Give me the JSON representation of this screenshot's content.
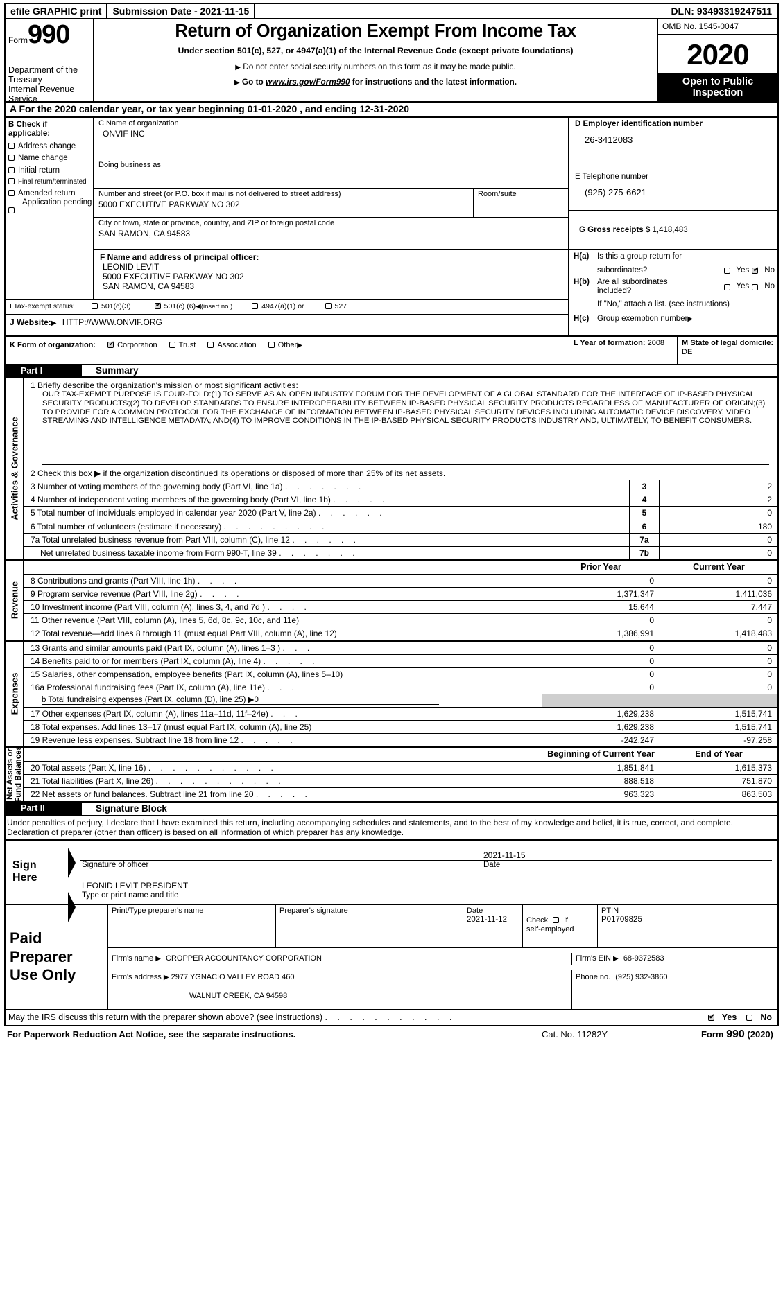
{
  "efile": {
    "graphic": "efile GRAPHIC print",
    "submission": "Submission Date - 2021-11-15",
    "dln": "DLN: 93493319247511"
  },
  "masthead": {
    "form_label": "Form",
    "form_number": "990",
    "department": "Department of the Treasury Internal Revenue Service",
    "title": "Return of Organization Exempt From Income Tax",
    "subtitle": "Under section 501(c), 527, or 4947(a)(1) of the Internal Revenue Code (except private foundations)",
    "bullet1": "Do not enter social security numbers on this form as it may be made public.",
    "bullet2_pre": "Go to ",
    "bullet2_link": "www.irs.gov/Form990",
    "bullet2_post": " for instructions and the latest information.",
    "omb": "OMB No. 1545-0047",
    "year": "2020",
    "open_line1": "Open to Public",
    "open_line2": "Inspection"
  },
  "lineA": "A   For the 2020 calendar year, or tax year beginning 01-01-2020   , and ending 12-31-2020",
  "checkbox_B": {
    "title": "B  Check if applicable:",
    "items": [
      {
        "label": "Address change",
        "checked": false
      },
      {
        "label": "Name change",
        "checked": false
      },
      {
        "label": "Initial return",
        "checked": false
      },
      {
        "label": "Final return/terminated",
        "checked": false
      },
      {
        "label": "Amended return",
        "checked": false
      },
      {
        "label": "Application pending",
        "checked": false
      }
    ]
  },
  "org": {
    "c_label": "C Name of organization",
    "c_value": "ONVIF INC",
    "dba_label": "Doing business as",
    "dba_value": "",
    "street_label": "Number and street (or P.O. box if mail is not delivered to street address)",
    "street_value": "5000 EXECUTIVE PARKWAY NO 302",
    "room_label": "Room/suite",
    "room_value": "",
    "city_label": "City or town, state or province, country, and ZIP or foreign postal code",
    "city_value": "SAN RAMON, CA  94583"
  },
  "right_boxes": {
    "d_label": "D Employer identification number",
    "d_value": "26-3412083",
    "e_label": "E Telephone number",
    "e_value": "(925) 275-6621",
    "g_label": "G Gross receipts $",
    "g_value": "1,418,483"
  },
  "officer": {
    "f_label": "F   Name and address of principal officer:",
    "name": "LEONID LEVIT",
    "address1": "5000 EXECUTIVE PARKWAY NO 302",
    "address2": "SAN RAMON, CA  94583"
  },
  "H": {
    "a_label": "H(a)",
    "a_text1": "Is this a group return for",
    "a_text2": "subordinates?",
    "a_yes": "Yes",
    "a_no": "No",
    "a_answer": "No",
    "b_label": "H(b)",
    "b_text1": "Are all subordinates",
    "b_text2": "included?",
    "b_yes": "Yes",
    "b_no": "No",
    "b_note": "If \"No,\" attach a list. (see instructions)",
    "c_label": "H(c)",
    "c_text": "Group exemption number"
  },
  "tax_exempt": {
    "label": "I   Tax-exempt status:",
    "opt1": "501(c)(3)",
    "opt1_checked": false,
    "opt2_pre": "501(c) (",
    "opt2_num": "6",
    "opt2_post": ")",
    "opt2_note": "(insert no.)",
    "opt2_checked": true,
    "opt3": "4947(a)(1) or",
    "opt3_checked": false,
    "opt4": "527",
    "opt4_checked": false
  },
  "website": {
    "label": "J   Website:",
    "value": "HTTP://WWW.ONVIF.ORG"
  },
  "form_org": {
    "label": "K Form of organization:",
    "options": [
      {
        "label": "Corporation",
        "checked": true
      },
      {
        "label": "Trust",
        "checked": false
      },
      {
        "label": "Association",
        "checked": false
      },
      {
        "label": "Other",
        "checked": false
      }
    ],
    "l_label": "L Year of formation:",
    "l_value": "2008",
    "m_label": "M State of legal domicile:",
    "m_value": "DE"
  },
  "part1": {
    "tag": "Part I",
    "name": "Summary",
    "side_label": "Activities & Governance",
    "line1_label": "1 Briefly describe the organization's mission or most significant activities:",
    "mission": "OUR TAX-EXEMPT PURPOSE IS FOUR-FOLD:(1) TO SERVE AS AN OPEN INDUSTRY FORUM FOR THE DEVELOPMENT OF A GLOBAL STANDARD FOR THE INTERFACE OF IP-BASED PHYSICAL SECURITY PRODUCTS;(2) TO DEVELOP STANDARDS TO ENSURE INTEROPERABILITY BETWEEN IP-BASED PHYSICAL SECURITY PRODUCTS REGARDLESS OF MANUFACTURER OF ORIGIN;(3) TO PROVIDE FOR A COMMON PROTOCOL FOR THE EXCHANGE OF INFORMATION BETWEEN IP-BASED PHYSICAL SECURITY DEVICES INCLUDING AUTOMATIC DEVICE DISCOVERY, VIDEO STREAMING AND INTELLIGENCE METADATA; AND(4) TO IMPROVE CONDITIONS IN THE IP-BASED PHYSICAL SECURITY PRODUCTS INDUSTRY AND, ULTIMATELY, TO BENEFIT CONSUMERS.",
    "line2": "2 Check this box ▶       if the organization discontinued its operations or disposed of more than 25% of its net assets.",
    "gov_rows": [
      {
        "text": "3 Number of voting members of the governing body (Part VI, line 1a)",
        "num": "3",
        "value": "2"
      },
      {
        "text": "4 Number of independent voting members of the governing body (Part VI, line 1b)",
        "num": "4",
        "value": "2"
      },
      {
        "text": "5 Total number of individuals employed in calendar year 2020 (Part V, line 2a)",
        "num": "5",
        "value": "0"
      },
      {
        "text": "6 Total number of volunteers (estimate if necessary)",
        "num": "6",
        "value": "180"
      },
      {
        "text": "7a Total unrelated business revenue from Part VIII, column (C), line 12",
        "num": "7a",
        "value": "0"
      },
      {
        "text": "Net unrelated business taxable income from Form 990-T, line 39",
        "num": "7b",
        "value": "0"
      }
    ],
    "col_prior": "Prior Year",
    "col_current": "Current Year",
    "revenue_side": "Revenue",
    "revenue_rows": [
      {
        "label": "8 Contributions and grants (Part VIII, line 1h)",
        "prior": "0",
        "current": "0"
      },
      {
        "label": "9 Program service revenue (Part VIII, line 2g)",
        "prior": "1,371,347",
        "current": "1,411,036"
      },
      {
        "label": "10 Investment income (Part VIII, column (A), lines 3, 4, and 7d )",
        "prior": "15,644",
        "current": "7,447"
      },
      {
        "label": "11 Other revenue (Part VIII, column (A), lines 5, 6d, 8c, 9c, 10c, and 11e)",
        "prior": "0",
        "current": "0"
      },
      {
        "label": "12 Total revenue—add lines 8 through 11 (must equal Part VIII, column (A), line 12)",
        "prior": "1,386,991",
        "current": "1,418,483"
      }
    ],
    "expenses_side": "Expenses",
    "expense_rows": [
      {
        "label": "13 Grants and similar amounts paid (Part IX, column (A), lines 1–3 )",
        "prior": "0",
        "current": "0"
      },
      {
        "label": "14 Benefits paid to or for members (Part IX, column (A), line 4)",
        "prior": "0",
        "current": "0"
      },
      {
        "label": "15 Salaries, other compensation, employee benefits (Part IX, column (A), lines 5–10)",
        "prior": "0",
        "current": "0"
      },
      {
        "label": "16a Professional fundraising fees (Part IX, column (A), line 11e)",
        "prior": "0",
        "current": "0"
      },
      {
        "label": "b Total fundraising expenses (Part IX, column (D), line 25) ▶0",
        "prior": "",
        "current": "",
        "gray": true
      },
      {
        "label": "17 Other expenses (Part IX, column (A), lines 11a–11d, 11f–24e)",
        "prior": "1,629,238",
        "current": "1,515,741"
      },
      {
        "label": "18 Total expenses. Add lines 13–17 (must equal Part IX, column (A), line 25)",
        "prior": "1,629,238",
        "current": "1,515,741"
      },
      {
        "label": "19 Revenue less expenses. Subtract line 18 from line 12",
        "prior": "-242,247",
        "current": "-97,258"
      }
    ],
    "netassets_side": "Net Assets or Fund Balances",
    "col_begin": "Beginning of Current Year",
    "col_end": "End of Year",
    "net_rows": [
      {
        "label": "20 Total assets (Part X, line 16)",
        "prior": "1,851,841",
        "current": "1,615,373"
      },
      {
        "label": "21 Total liabilities (Part X, line 26)",
        "prior": "888,518",
        "current": "751,870"
      },
      {
        "label": "22 Net assets or fund balances. Subtract line 21 from line 20",
        "prior": "963,323",
        "current": "863,503"
      }
    ]
  },
  "part2": {
    "tag": "Part II",
    "name": "Signature Block",
    "perjury": "Under penalties of perjury, I declare that I have examined this return, including accompanying schedules and statements, and to the best of my knowledge and belief, it is true, correct, and complete. Declaration of preparer (other than officer) is based on all information of which preparer has any knowledge.",
    "sign_here1": "Sign",
    "sign_here2": "Here",
    "sig_officer_cap": "Signature of officer",
    "sig_date_cap": "Date",
    "sig_date_value": "2021-11-15",
    "sig_name_value": "LEONID LEVIT  PRESIDENT",
    "sig_name_cap": "Type or print name and title"
  },
  "preparer": {
    "tag1": "Paid",
    "tag2": "Preparer",
    "tag3": "Use Only",
    "name_cap": "Print/Type preparer's name",
    "name_value": "",
    "sig_cap": "Preparer's signature",
    "sig_value": "",
    "date_cap": "Date",
    "date_value": "2021-11-12",
    "check_cap1": "Check",
    "check_cap2": "if",
    "check_cap3": "self-employed",
    "check_checked": false,
    "ptin_cap": "PTIN",
    "ptin_value": "P01709825",
    "firm_name_cap": "Firm's name",
    "firm_name_value": "CROPPER ACCOUNTANCY CORPORATION",
    "firm_ein_cap": "Firm's EIN",
    "firm_ein_value": "68-9372583",
    "firm_addr_cap": "Firm's address",
    "firm_addr_value": "2977 YGNACIO VALLEY ROAD 460",
    "firm_addr_value2": "WALNUT CREEK, CA  94598",
    "phone_cap": "Phone no.",
    "phone_value": "(925) 932-3860"
  },
  "irs_question": {
    "text": "May the IRS discuss this return with the preparer shown above? (see instructions)",
    "yes": "Yes",
    "no": "No",
    "answer": "Yes"
  },
  "footer": {
    "notice": "For Paperwork Reduction Act Notice, see the separate instructions.",
    "cat": "Cat. No. 11282Y",
    "form_pre": "Form ",
    "form_num": "990",
    "form_year": " (2020)"
  }
}
